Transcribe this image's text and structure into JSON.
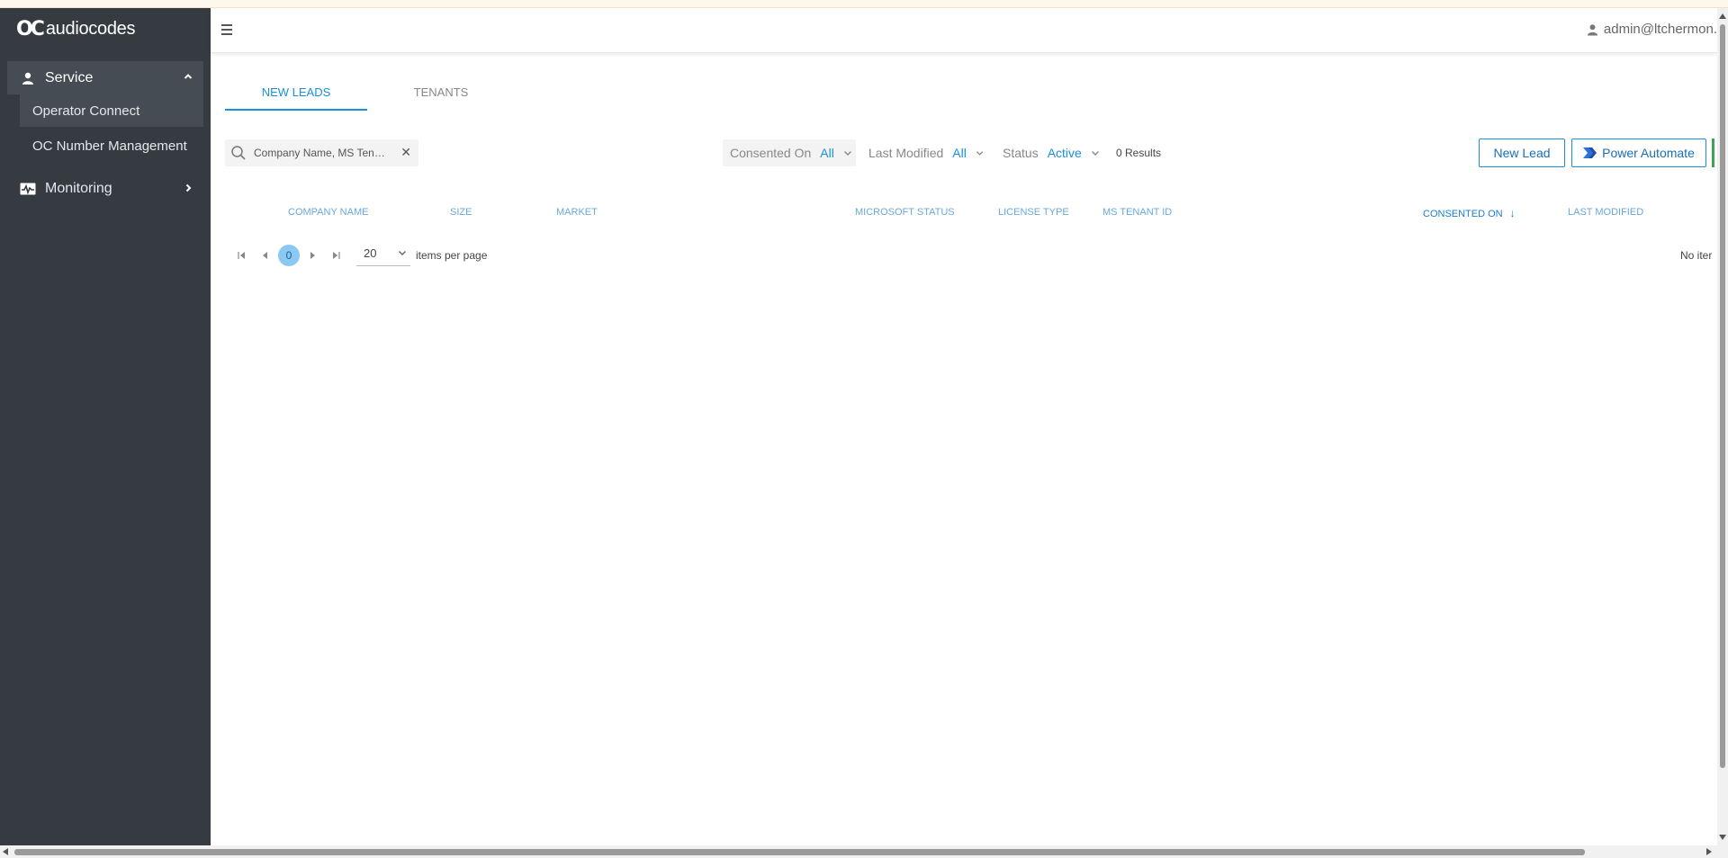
{
  "brand": {
    "mark": "OC",
    "name": "audiocodes"
  },
  "sidebar": {
    "service": {
      "label": "Service",
      "icon": "user-icon"
    },
    "sub_items": [
      {
        "label": "Operator Connect",
        "active": true
      },
      {
        "label": "OC Number Management",
        "active": false
      }
    ],
    "monitoring": {
      "label": "Monitoring",
      "icon": "monitoring-icon"
    }
  },
  "header": {
    "user": "admin@ltchermon."
  },
  "tabs": [
    {
      "label": "NEW LEADS",
      "active": true
    },
    {
      "label": "TENANTS",
      "active": false
    }
  ],
  "toolbar": {
    "search_value": "Company Name, MS Tena...",
    "filters": [
      {
        "label": "Consented On",
        "value": "All"
      },
      {
        "label": "Last Modified",
        "value": "All"
      },
      {
        "label": "Status",
        "value": "Active"
      }
    ],
    "results": "0 Results",
    "new_lead": "New Lead",
    "power_automate": "Power Automate"
  },
  "table": {
    "columns": [
      "COMPANY NAME",
      "SIZE",
      "MARKET",
      "MICROSOFT STATUS",
      "LICENSE TYPE",
      "MS TENANT ID",
      "CONSENTED ON",
      "LAST MODIFIED"
    ],
    "sorted_column": "CONSENTED ON"
  },
  "pager": {
    "page": "0",
    "per_page": "20",
    "per_page_label": "items per page",
    "empty_text": "No iter"
  },
  "colors": {
    "sidebar": "#353b41",
    "accent": "#1a8fdf",
    "badge": "#8cc9f2"
  }
}
